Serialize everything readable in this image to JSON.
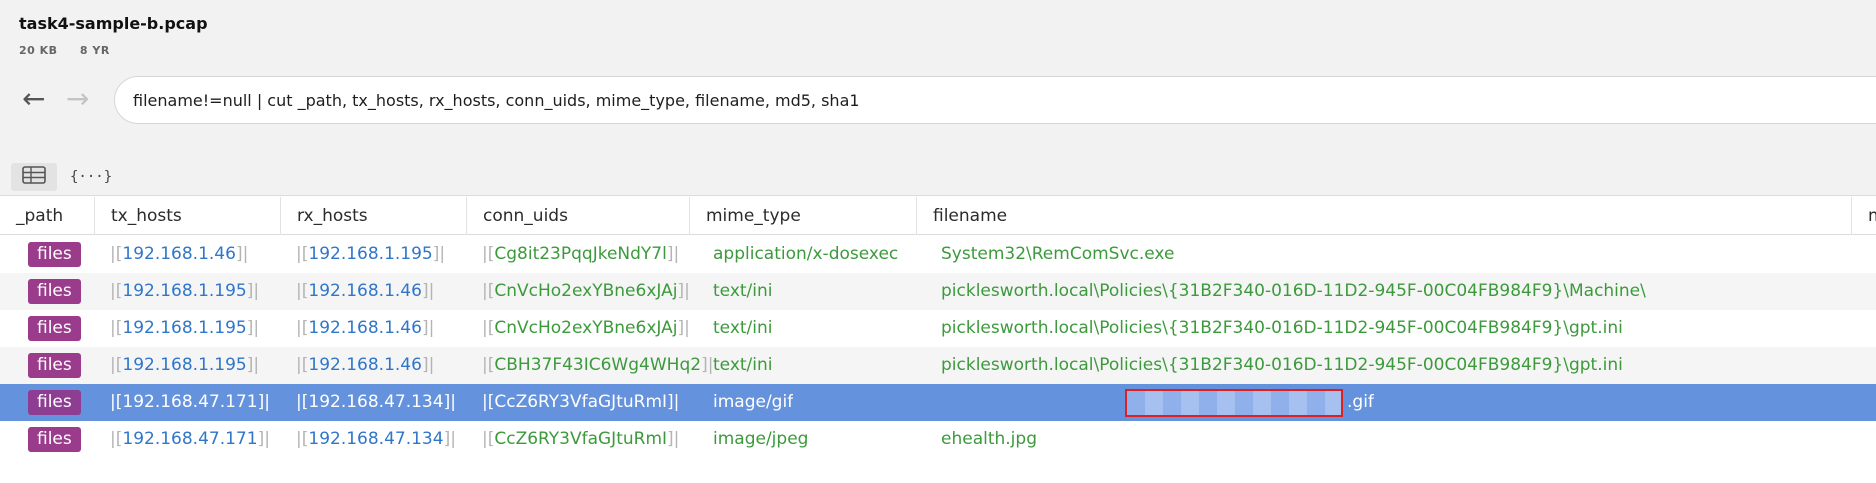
{
  "file": {
    "title": "task4-sample-b.pcap",
    "size": "20 KB",
    "age": "8 YR"
  },
  "nav": {
    "back": "←",
    "forward": "→"
  },
  "query": "filename!=null | cut _path, tx_hosts, rx_hosts, conn_uids, mime_type, filename, md5, sha1",
  "view": {
    "table_icon": "table-icon",
    "json_icon": "{···}"
  },
  "columns": [
    "_path",
    "tx_hosts",
    "rx_hosts",
    "conn_uids",
    "mime_type",
    "filename",
    "m"
  ],
  "rows": [
    {
      "path": "files",
      "tx": "192.168.1.46",
      "rx": "192.168.1.195",
      "uid": "Cg8it23PqqJkeNdY7l",
      "mime": "application/x-dosexec",
      "filename": "System32\\RemComSvc.exe"
    },
    {
      "path": "files",
      "tx": "192.168.1.195",
      "rx": "192.168.1.46",
      "uid": "CnVcHo2exYBne6xJAj",
      "mime": "text/ini",
      "filename": "picklesworth.local\\Policies\\{31B2F340-016D-11D2-945F-00C04FB984F9}\\Machine\\"
    },
    {
      "path": "files",
      "tx": "192.168.1.195",
      "rx": "192.168.1.46",
      "uid": "CnVcHo2exYBne6xJAj",
      "mime": "text/ini",
      "filename": "picklesworth.local\\Policies\\{31B2F340-016D-11D2-945F-00C04FB984F9}\\gpt.ini"
    },
    {
      "path": "files",
      "tx": "192.168.1.195",
      "rx": "192.168.1.46",
      "uid": "CBH37F43IC6Wg4WHq2",
      "mime": "text/ini",
      "filename": "picklesworth.local\\Policies\\{31B2F340-016D-11D2-945F-00C04FB984F9}\\gpt.ini"
    },
    {
      "path": "files",
      "tx": "192.168.47.171",
      "rx": "192.168.47.134",
      "uid": "CcZ6RY3VfaGJtuRmI",
      "mime": "image/gif",
      "filename": ".gif"
    },
    {
      "path": "files",
      "tx": "192.168.47.171",
      "rx": "192.168.47.134",
      "uid": "CcZ6RY3VfaGJtuRmI",
      "mime": "image/jpeg",
      "filename": "ehealth.jpg"
    }
  ],
  "brackets": {
    "open": "|[",
    "close": "]|"
  },
  "colors": {
    "badge": "#9a3b8c",
    "selected": "#6592dc",
    "ip": "#2f76c9",
    "green": "#3c9a3c"
  }
}
